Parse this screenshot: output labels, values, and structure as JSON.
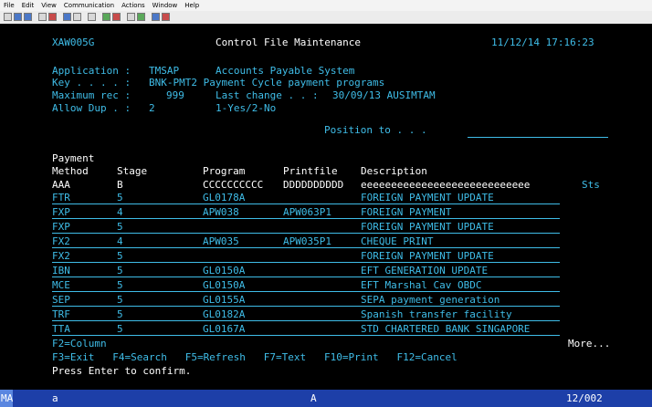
{
  "menu": [
    "File",
    "Edit",
    "View",
    "Communication",
    "Actions",
    "Window",
    "Help"
  ],
  "screen": {
    "screen_id": "XAW005G",
    "title": "Control File Maintenance",
    "datetime": "11/12/14 17:16:23",
    "fields": {
      "application_label": "Application :",
      "application_code": "TMSAP",
      "application_desc": "Accounts Payable System",
      "key_label": "Key . . . . :",
      "key_value": "BNK-PMT2 Payment Cycle payment programs",
      "maxrec_label": "Maximum rec :",
      "maxrec_value": "999",
      "lastchange_label": "Last change . . :",
      "lastchange_value": "30/09/13 AUSIMTAM",
      "allowdup_label": "Allow Dup . :",
      "allowdup_value": "2",
      "allowdup_options": "1-Yes/2-No",
      "position_label": "Position to . . ."
    },
    "headers": {
      "payment": "Payment",
      "method": "Method",
      "stage": "Stage",
      "program": "Program",
      "printfile": "Printfile",
      "description": "Description",
      "sts": "Sts"
    },
    "mask": {
      "method": "AAA",
      "stage": "B",
      "program": "CCCCCCCCCC",
      "printfile": "DDDDDDDDDD",
      "description": "eeeeeeeeeeeeeeeeeeeeeeeeeeee"
    },
    "rows": [
      {
        "method": "FTR",
        "stage": "5",
        "program": "GL0178A",
        "printfile": "",
        "description": "FOREIGN PAYMENT UPDATE"
      },
      {
        "method": "FXP",
        "stage": "4",
        "program": "APW038",
        "printfile": "APW063P1",
        "description": "FOREIGN PAYMENT"
      },
      {
        "method": "FXP",
        "stage": "5",
        "program": "",
        "printfile": "",
        "description": "FOREIGN PAYMENT UPDATE"
      },
      {
        "method": "FX2",
        "stage": "4",
        "program": "APW035",
        "printfile": "APW035P1",
        "description": "CHEQUE PRINT"
      },
      {
        "method": "FX2",
        "stage": "5",
        "program": "",
        "printfile": "",
        "description": "FOREIGN PAYMENT UPDATE"
      },
      {
        "method": "IBN",
        "stage": "5",
        "program": "GL0150A",
        "printfile": "",
        "description": "EFT GENERATION UPDATE"
      },
      {
        "method": "MCE",
        "stage": "5",
        "program": "GL0150A",
        "printfile": "",
        "description": "EFT Marshal Cav OBDC"
      },
      {
        "method": "SEP",
        "stage": "5",
        "program": "GL0155A",
        "printfile": "",
        "description": "SEPA payment generation"
      },
      {
        "method": "TRF",
        "stage": "5",
        "program": "GL0182A",
        "printfile": "",
        "description": "Spanish transfer facility"
      },
      {
        "method": "TTA",
        "stage": "5",
        "program": "GL0167A",
        "printfile": "",
        "description": "STD CHARTERED BANK SINGAPORE"
      }
    ],
    "fkeys_line1": "F2=Column",
    "more": "More...",
    "fkeys_line2": "F3=Exit   F4=Search   F5=Refresh   F7=Text   F10=Print   F12=Cancel",
    "prompt": "Press Enter to confirm."
  },
  "status": {
    "mode": "MA",
    "session": "a",
    "indicator": "A",
    "cursor": "12/002"
  }
}
